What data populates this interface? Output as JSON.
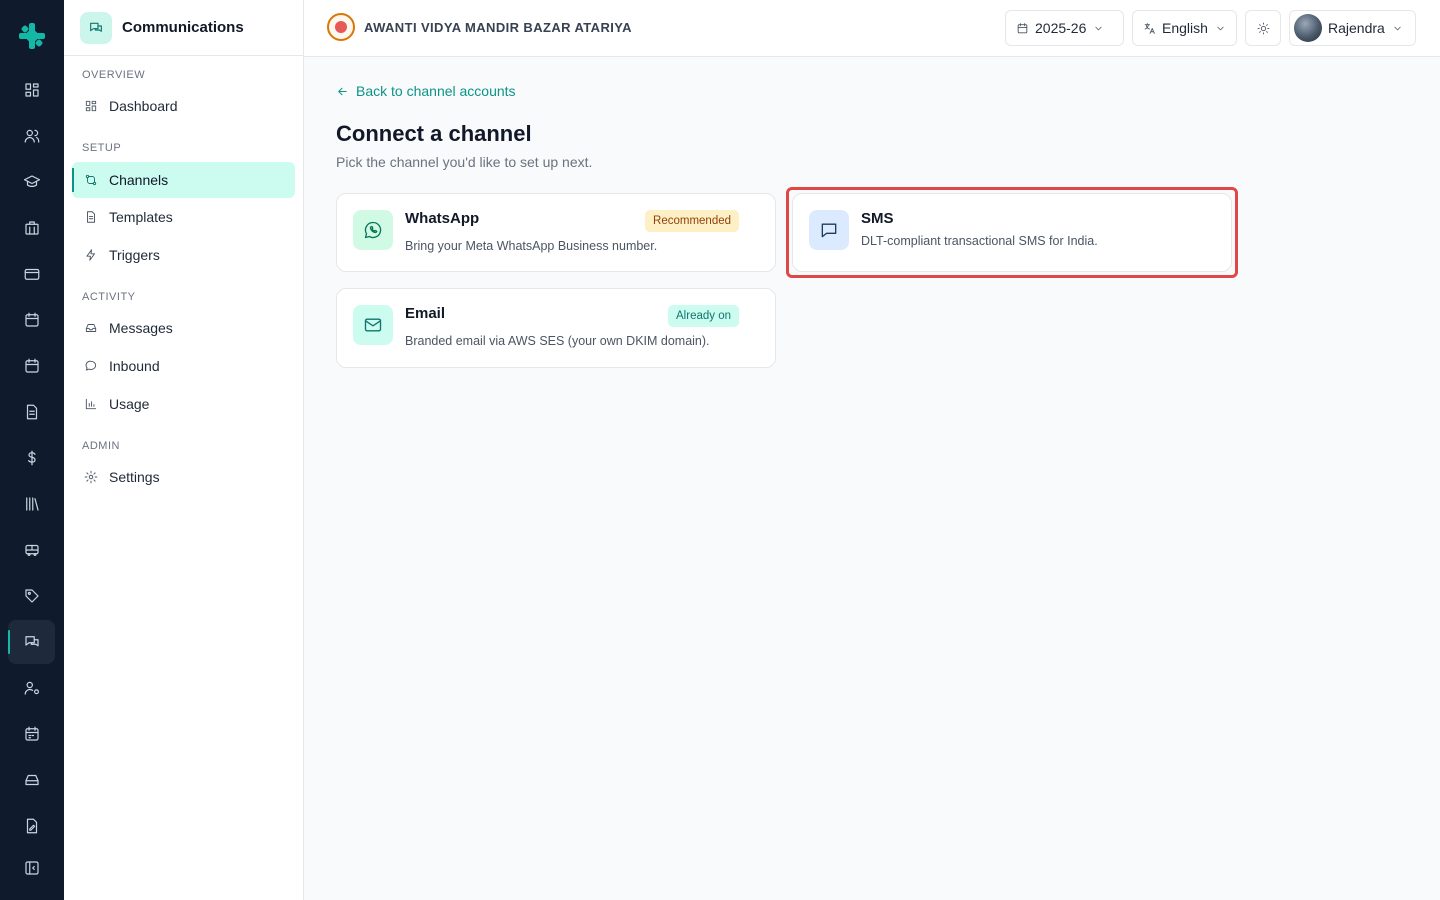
{
  "sidebar": {
    "title": "Communications",
    "sections": {
      "overview": "OVERVIEW",
      "setup": "SETUP",
      "activity": "ACTIVITY",
      "admin": "ADMIN"
    },
    "items": {
      "dashboard": "Dashboard",
      "channels": "Channels",
      "templates": "Templates",
      "triggers": "Triggers",
      "messages": "Messages",
      "inbound": "Inbound",
      "usage": "Usage",
      "settings": "Settings"
    }
  },
  "topbar": {
    "school_name": "AWANTI VIDYA MANDIR BAZAR ATARIYA",
    "academic_year": "2025-26",
    "language": "English",
    "user_name": "Rajendra"
  },
  "main": {
    "back_link": "Back to channel accounts",
    "title": "Connect a channel",
    "subtitle": "Pick the channel you'd like to set up next.",
    "channels": {
      "whatsapp": {
        "name": "WhatsApp",
        "badge": "Recommended",
        "description": "Bring your Meta WhatsApp Business number."
      },
      "sms": {
        "name": "SMS",
        "description": "DLT-compliant transactional SMS for India."
      },
      "email": {
        "name": "Email",
        "badge": "Already on",
        "description": "Branded email via AWS SES (your own DKIM domain)."
      }
    }
  },
  "colors": {
    "accent": "#0d9488",
    "rail_bg": "#0f1b2d",
    "highlight": "#e04848"
  }
}
